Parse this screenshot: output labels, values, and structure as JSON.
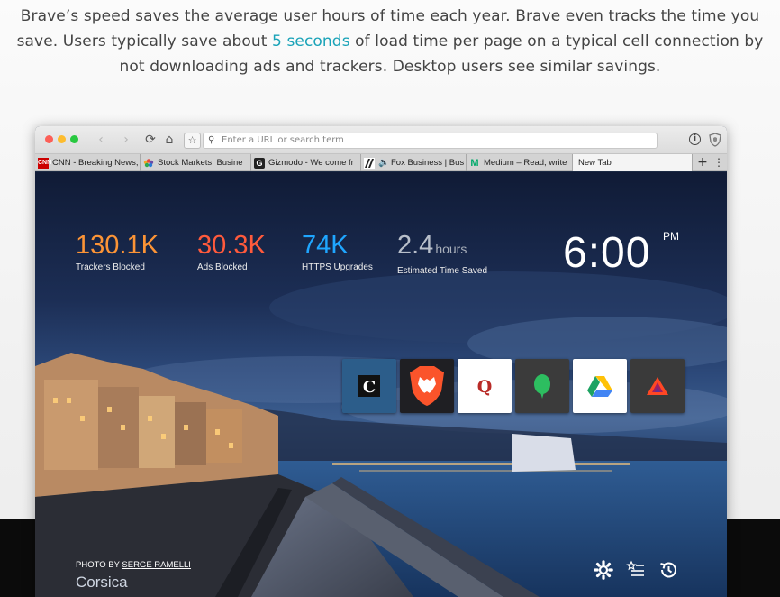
{
  "intro": {
    "line1": "Brave’s speed saves the average user hours of time each year. Brave even tracks the time you",
    "line2_before": "save. Users typically save about ",
    "line2_highlight": "5 seconds",
    "line2_after": " of load time per page on a typical cell connection by",
    "line3": "not downloading ads and trackers. Desktop users see similar savings."
  },
  "browser": {
    "url_placeholder": "Enter a URL or search term",
    "tabs": [
      {
        "label": "CNN - Breaking News,",
        "favicon": "cnn-icon",
        "favicon_text": "CNN",
        "color": "#cc0000"
      },
      {
        "label": "Stock Markets, Busine",
        "favicon": "nbc-peacock-icon",
        "favicon_text": "",
        "color": "#6c4aa6"
      },
      {
        "label": "Gizmodo - We come fr",
        "favicon": "gizmodo-icon",
        "favicon_text": "G",
        "color": "#222222"
      },
      {
        "label": "Fox Business | Bus",
        "favicon": "fox-business-icon",
        "favicon_text": "",
        "color": "#222222"
      },
      {
        "label": "Medium – Read, write",
        "favicon": "medium-icon",
        "favicon_text": "M",
        "color": "#00ab6c"
      },
      {
        "label": "New Tab",
        "favicon": "",
        "favicon_text": "",
        "color": ""
      }
    ]
  },
  "new_tab": {
    "stats": [
      {
        "value": "130.1K",
        "unit": "",
        "label": "Trackers Blocked",
        "color": "#fc9436"
      },
      {
        "value": "30.3K",
        "unit": "",
        "label": "Ads Blocked",
        "color": "#ff5a3c"
      },
      {
        "value": "74K",
        "unit": "",
        "label": "HTTPS Upgrades",
        "color": "#1fa6ff"
      },
      {
        "value": "2.4",
        "unit": "hours",
        "label": "Estimated Time Saved",
        "color": "#b8bfca"
      }
    ],
    "clock": "6:00",
    "ampm": "PM",
    "tiles": [
      "chicago-tribune-icon",
      "brave-lion-icon",
      "quora-icon",
      "evernote-icon",
      "google-drive-icon",
      "brave-bat-icon"
    ],
    "photo_by": "PHOTO BY",
    "photographer": "SERGE RAMELLI",
    "location": "Corsica"
  }
}
